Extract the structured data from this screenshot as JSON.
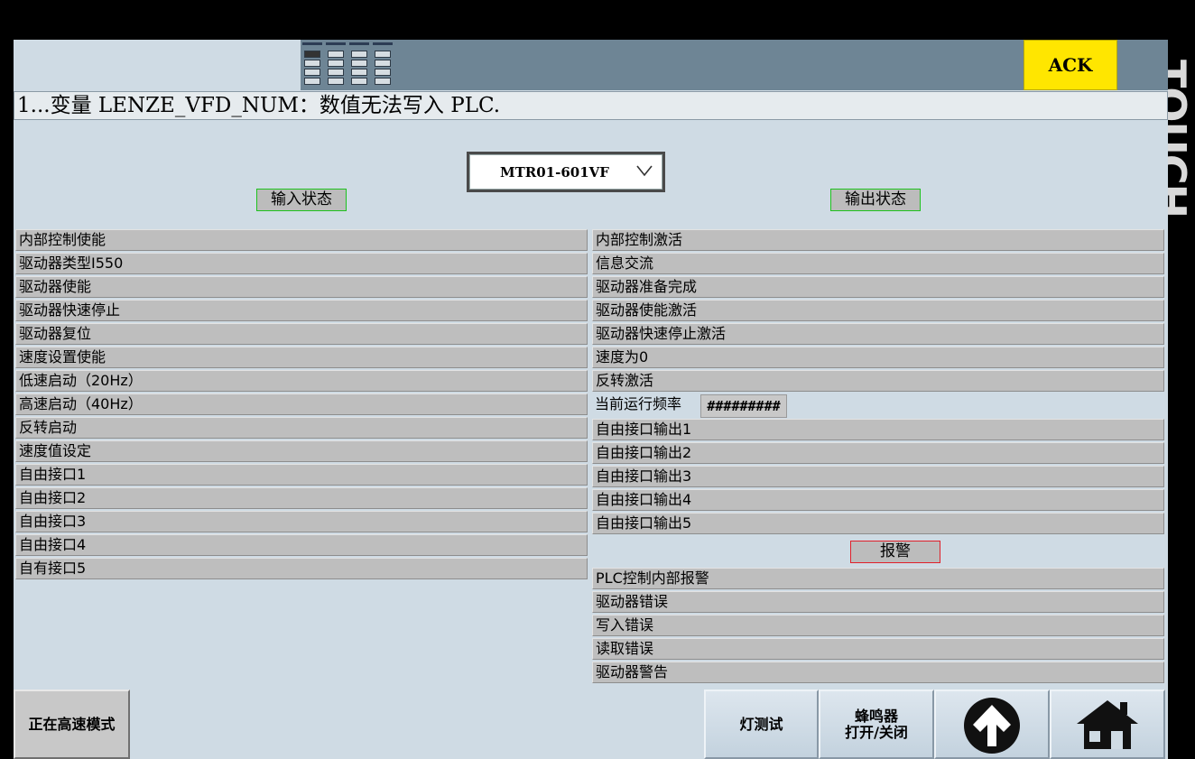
{
  "header": {
    "ack_label": "ACK",
    "side_brand": "TOUCH"
  },
  "alarm": {
    "message": "1...变量 LENZE_VFD_NUM：数值无法写入 PLC."
  },
  "device": {
    "selected": "MTR01-601VF"
  },
  "sections": {
    "input": "输入状态",
    "output": "输出状态",
    "alarm": "报警"
  },
  "inputs": [
    "内部控制使能",
    "驱动器类型I550",
    "驱动器使能",
    "驱动器快速停止",
    "驱动器复位",
    "速度设置使能",
    "低速启动（20Hz）",
    "高速启动（40Hz）",
    "反转启动",
    "速度值设定",
    "自由接口1",
    "自由接口2",
    "自由接口3",
    "自由接口4",
    "自有接口5"
  ],
  "outputs": [
    "内部控制激活",
    "信息交流",
    "驱动器准备完成",
    "驱动器使能激活",
    "驱动器快速停止激活",
    "速度为0",
    "反转激活",
    "当前运行频率",
    "自由接口输出1",
    "自由接口输出2",
    "自由接口输出3",
    "自由接口输出4",
    "自由接口输出5"
  ],
  "frequency_value": "#########",
  "alarms": [
    "PLC控制内部报警",
    "驱动器错误",
    "写入错误",
    "读取错误",
    "驱动器警告"
  ],
  "buttons": {
    "mode": "正在高速模式",
    "lamp_test": "灯测试",
    "buzzer_line1": "蜂鸣器",
    "buzzer_line2": "打开/关闭"
  },
  "icons": {
    "grid": "screen-grid-icon",
    "up": "up-arrow-icon",
    "home": "home-icon",
    "dropdown": "chevron-down-icon"
  }
}
